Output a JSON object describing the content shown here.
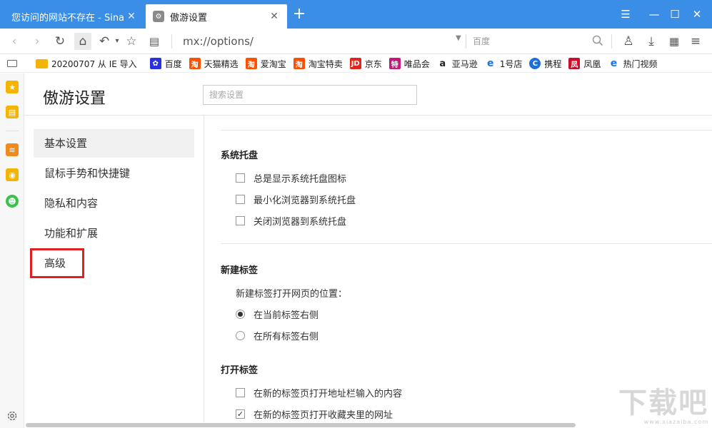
{
  "tabs": [
    {
      "title": "您访问的网站不存在 - Sina A",
      "active": false
    },
    {
      "title": "傲游设置",
      "active": true
    }
  ],
  "window_controls": {
    "menu": "☰",
    "minimize": "—",
    "maximize": "☐",
    "close": "✕"
  },
  "navbar": {
    "address": "mx://options/",
    "search_placeholder": "百度"
  },
  "bookmarks": [
    {
      "label": "20200707 从 IE 导入",
      "icon": "folder-icon",
      "color": "#f2b400"
    },
    {
      "label": "百度",
      "icon": "baidu-icon",
      "color": "#2932e1"
    },
    {
      "label": "天猫精选",
      "icon": "taobao-icon",
      "color": "#ff5000"
    },
    {
      "label": "爱淘宝",
      "icon": "taobao-icon",
      "color": "#ff5000"
    },
    {
      "label": "淘宝特卖",
      "icon": "taobao-icon",
      "color": "#ff5000"
    },
    {
      "label": "京东",
      "icon": "jd-icon",
      "color": "#e1251b"
    },
    {
      "label": "唯品会",
      "icon": "vip-icon",
      "color": "#c7197b"
    },
    {
      "label": "亚马逊",
      "icon": "amazon-icon",
      "color": "#222222"
    },
    {
      "label": "1号店",
      "icon": "ie-icon",
      "color": "#1a73e8"
    },
    {
      "label": "携程",
      "icon": "ctrip-icon",
      "color": "#1e6fd9"
    },
    {
      "label": "凤凰",
      "icon": "ifeng-icon",
      "color": "#c8102e"
    },
    {
      "label": "热门视频",
      "icon": "ie-icon",
      "color": "#1a73e8"
    }
  ],
  "page": {
    "title": "傲游设置",
    "search_placeholder": "搜索设置"
  },
  "nav_items": [
    {
      "label": "基本设置",
      "selected": true
    },
    {
      "label": "鼠标手势和快捷键",
      "selected": false
    },
    {
      "label": "隐私和内容",
      "selected": false
    },
    {
      "label": "功能和扩展",
      "selected": false
    },
    {
      "label": "高级",
      "selected": false,
      "highlighted": true
    }
  ],
  "sections": {
    "tray": {
      "title": "系统托盘",
      "options": [
        {
          "label": "总是显示系统托盘图标",
          "checked": false
        },
        {
          "label": "最小化浏览器到系统托盘",
          "checked": false
        },
        {
          "label": "关闭浏览器到系统托盘",
          "checked": false
        }
      ]
    },
    "new_tab": {
      "title": "新建标签",
      "sub_label": "新建标签打开网页的位置：",
      "options": [
        {
          "label": "在当前标签右侧",
          "selected": true
        },
        {
          "label": "在所有标签右侧",
          "selected": false
        }
      ]
    },
    "open_tab": {
      "title": "打开标签",
      "options": [
        {
          "label": "在新的标签页打开地址栏输入的内容",
          "checked": false
        },
        {
          "label": "在新的标签页打开收藏夹里的网址",
          "checked": true
        }
      ]
    }
  },
  "watermark": {
    "big": "下载吧",
    "small": "www.xiazaiba.com"
  },
  "colors": {
    "titlebar": "#3a8ee6",
    "highlight": "#e02020"
  }
}
